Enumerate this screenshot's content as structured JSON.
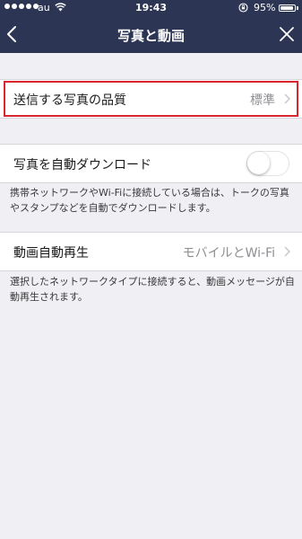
{
  "status_bar": {
    "carrier": "au",
    "time": "19:43",
    "battery_percent": "95%",
    "battery_level": 0.95,
    "signal_dots": 5,
    "icons": [
      "signal-dots-icon",
      "wifi-icon",
      "rotation-lock-icon",
      "battery-icon"
    ]
  },
  "nav": {
    "title": "写真と動画",
    "back_icon": "chevron-left-icon",
    "close_icon": "close-icon"
  },
  "settings": {
    "photo_quality": {
      "label": "送信する写真の品質",
      "value": "標準"
    },
    "auto_download": {
      "label": "写真を自動ダウンロード",
      "enabled": false,
      "note": "携帯ネットワークやWi-Fiに接続している場合は、トークの写真やスタンプなどを自動でダウンロードします。"
    },
    "autoplay": {
      "label": "動画自動再生",
      "value": "モバイルとWi-Fi",
      "note": "選択したネットワークタイプに接続すると、動画メッセージが自動再生されます。"
    }
  },
  "colors": {
    "header_bg": "#2c3554",
    "page_bg": "#efeff4",
    "highlight": "#d9262d"
  }
}
